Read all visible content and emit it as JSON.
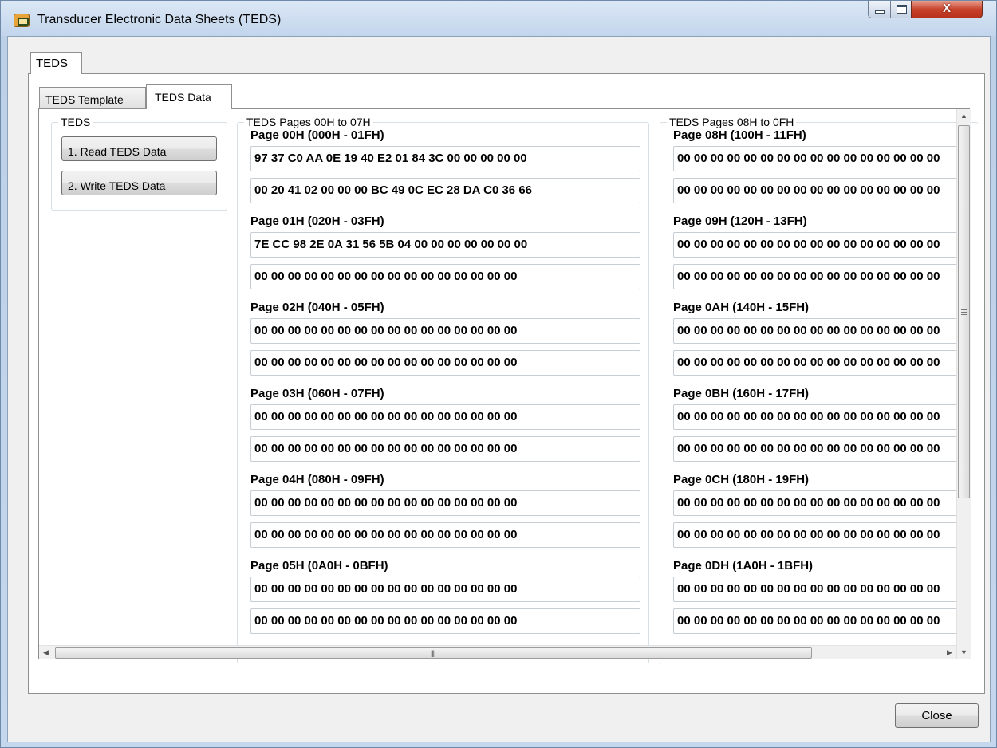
{
  "window": {
    "title": "Transducer Electronic Data Sheets (TEDS)",
    "close_glyph": "X"
  },
  "tabs": {
    "outer": "TEDS",
    "inner": [
      "TEDS Template",
      "TEDS Data"
    ],
    "inner_selected": "TEDS Data"
  },
  "teds_group": {
    "legend": "TEDS",
    "read_button": "1. Read TEDS Data",
    "write_button": "2. Write TEDS Data"
  },
  "left_group": {
    "legend": "TEDS Pages 00H to 07H",
    "pages": [
      {
        "label": "Page 00H (000H - 01FH)",
        "row1": "97 37 C0 AA 0E 19 40 E2 01 84 3C 00 00 00 00 00",
        "row2": "00 20 41 02 00 00 00 BC 49 0C EC 28 DA C0 36 66"
      },
      {
        "label": "Page 01H (020H - 03FH)",
        "row1": "7E CC 98 2E 0A 31 56 5B 04 00 00 00 00 00 00 00",
        "row2": "00 00 00 00 00 00 00 00 00 00 00 00 00 00 00 00"
      },
      {
        "label": "Page 02H (040H - 05FH)",
        "row1": "00 00 00 00 00 00 00 00 00 00 00 00 00 00 00 00",
        "row2": "00 00 00 00 00 00 00 00 00 00 00 00 00 00 00 00"
      },
      {
        "label": "Page 03H (060H - 07FH)",
        "row1": "00 00 00 00 00 00 00 00 00 00 00 00 00 00 00 00",
        "row2": "00 00 00 00 00 00 00 00 00 00 00 00 00 00 00 00"
      },
      {
        "label": "Page 04H (080H - 09FH)",
        "row1": "00 00 00 00 00 00 00 00 00 00 00 00 00 00 00 00",
        "row2": "00 00 00 00 00 00 00 00 00 00 00 00 00 00 00 00"
      },
      {
        "label": "Page 05H (0A0H - 0BFH)",
        "row1": "00 00 00 00 00 00 00 00 00 00 00 00 00 00 00 00",
        "row2": "00 00 00 00 00 00 00 00 00 00 00 00 00 00 00 00"
      }
    ]
  },
  "right_group": {
    "legend": "TEDS Pages 08H to 0FH",
    "pages": [
      {
        "label": "Page 08H (100H - 11FH)",
        "row1": "00 00 00 00 00 00 00 00 00 00 00 00 00 00 00 00",
        "row2": "00 00 00 00 00 00 00 00 00 00 00 00 00 00 00 00"
      },
      {
        "label": "Page 09H (120H - 13FH)",
        "row1": "00 00 00 00 00 00 00 00 00 00 00 00 00 00 00 00",
        "row2": "00 00 00 00 00 00 00 00 00 00 00 00 00 00 00 00"
      },
      {
        "label": "Page 0AH (140H - 15FH)",
        "row1": "00 00 00 00 00 00 00 00 00 00 00 00 00 00 00 00",
        "row2": "00 00 00 00 00 00 00 00 00 00 00 00 00 00 00 00"
      },
      {
        "label": "Page 0BH (160H - 17FH)",
        "row1": "00 00 00 00 00 00 00 00 00 00 00 00 00 00 00 00",
        "row2": "00 00 00 00 00 00 00 00 00 00 00 00 00 00 00 00"
      },
      {
        "label": "Page 0CH (180H - 19FH)",
        "row1": "00 00 00 00 00 00 00 00 00 00 00 00 00 00 00 00",
        "row2": "00 00 00 00 00 00 00 00 00 00 00 00 00 00 00 00"
      },
      {
        "label": "Page 0DH (1A0H - 1BFH)",
        "row1": "00 00 00 00 00 00 00 00 00 00 00 00 00 00 00 00",
        "row2": "00 00 00 00 00 00 00 00 00 00 00 00 00 00 00 00"
      }
    ]
  },
  "footer": {
    "close_button": "Close"
  },
  "colors": {
    "titlebar": "#c2d5ec",
    "close_button_red": "#c8442c",
    "panel_background": "#f0f0f0"
  },
  "icons": [
    "app-icon",
    "minimize-icon",
    "maximize-icon",
    "close-icon",
    "scroll-up-icon",
    "scroll-down-icon",
    "scroll-left-icon",
    "scroll-right-icon"
  ]
}
